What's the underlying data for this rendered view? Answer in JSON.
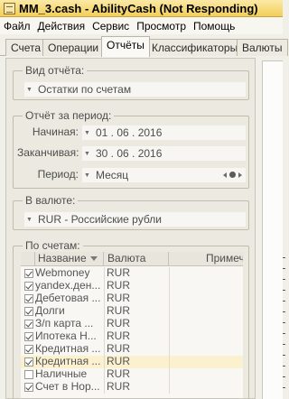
{
  "window": {
    "title": "MM_3.cash - AbilityCash (Not Responding)"
  },
  "menu": [
    "Файл",
    "Действия",
    "Сервис",
    "Просмотр",
    "Помощь"
  ],
  "tabs": [
    {
      "label": "Счета",
      "active": false
    },
    {
      "label": "Операции",
      "active": false
    },
    {
      "label": "Отчёты",
      "active": true
    },
    {
      "label": "Классификаторы",
      "active": false
    },
    {
      "label": "Валюты",
      "active": false
    }
  ],
  "report_type": {
    "title": "Вид отчёта:",
    "value": "Остатки по счетам"
  },
  "period": {
    "title": "Отчёт за период:",
    "start_label": "Начиная:",
    "start_value": "01 . 06 . 2016",
    "end_label": "Заканчивая:",
    "end_value": "30 . 06 . 2016",
    "period_label": "Период:",
    "period_value": "Месяц"
  },
  "currency": {
    "title": "В валюте:",
    "value": "RUR - Российские рубли"
  },
  "accounts": {
    "title": "По счетам:",
    "columns": [
      "Название",
      "Валюта",
      "Примеч"
    ],
    "rows": [
      {
        "name": "Webmoney",
        "currency": "RUR",
        "checked": true
      },
      {
        "name": "yandex.ден...",
        "currency": "RUR",
        "checked": true
      },
      {
        "name": "Дебетовая ...",
        "currency": "RUR",
        "checked": true
      },
      {
        "name": "Долги",
        "currency": "RUR",
        "checked": true
      },
      {
        "name": "З/п карта ...",
        "currency": "RUR",
        "checked": true
      },
      {
        "name": "Ипотека Н...",
        "currency": "RUR",
        "checked": true
      },
      {
        "name": "Кредитная ...",
        "currency": "RUR",
        "checked": true
      },
      {
        "name": "Кредитная ...",
        "currency": "RUR",
        "checked": true
      },
      {
        "name": "Наличные",
        "currency": "RUR",
        "checked": false
      },
      {
        "name": "Счет в Нор...",
        "currency": "RUR",
        "checked": true
      }
    ],
    "selected_row": 7
  },
  "colors": {
    "title_bar": "#f3cf59",
    "selected_row": "#fbf1cf"
  }
}
